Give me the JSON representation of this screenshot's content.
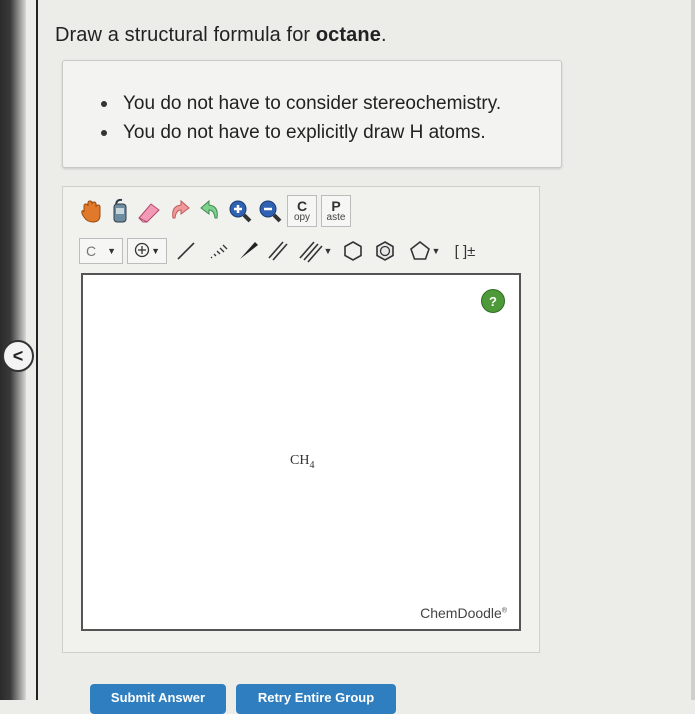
{
  "question": {
    "prefix": "Draw a structural formula for ",
    "compound": "octane",
    "suffix": "."
  },
  "hints": [
    "You do not have to consider stereochemistry.",
    "You do not have to explicitly draw H atoms."
  ],
  "toolbar": {
    "copy": {
      "big": "C",
      "small": "opy"
    },
    "paste": {
      "big": "P",
      "small": "aste"
    },
    "element_value": "C",
    "brackets_label": "[ ]±"
  },
  "canvas": {
    "molecule_text": "CH",
    "molecule_sub": "4",
    "help_label": "?",
    "brand": "ChemDoodle",
    "brand_mark": "®"
  },
  "nav": {
    "collapse_glyph": "<"
  },
  "buttons": {
    "submit": "Submit Answer",
    "retry": "Retry Entire Group"
  }
}
